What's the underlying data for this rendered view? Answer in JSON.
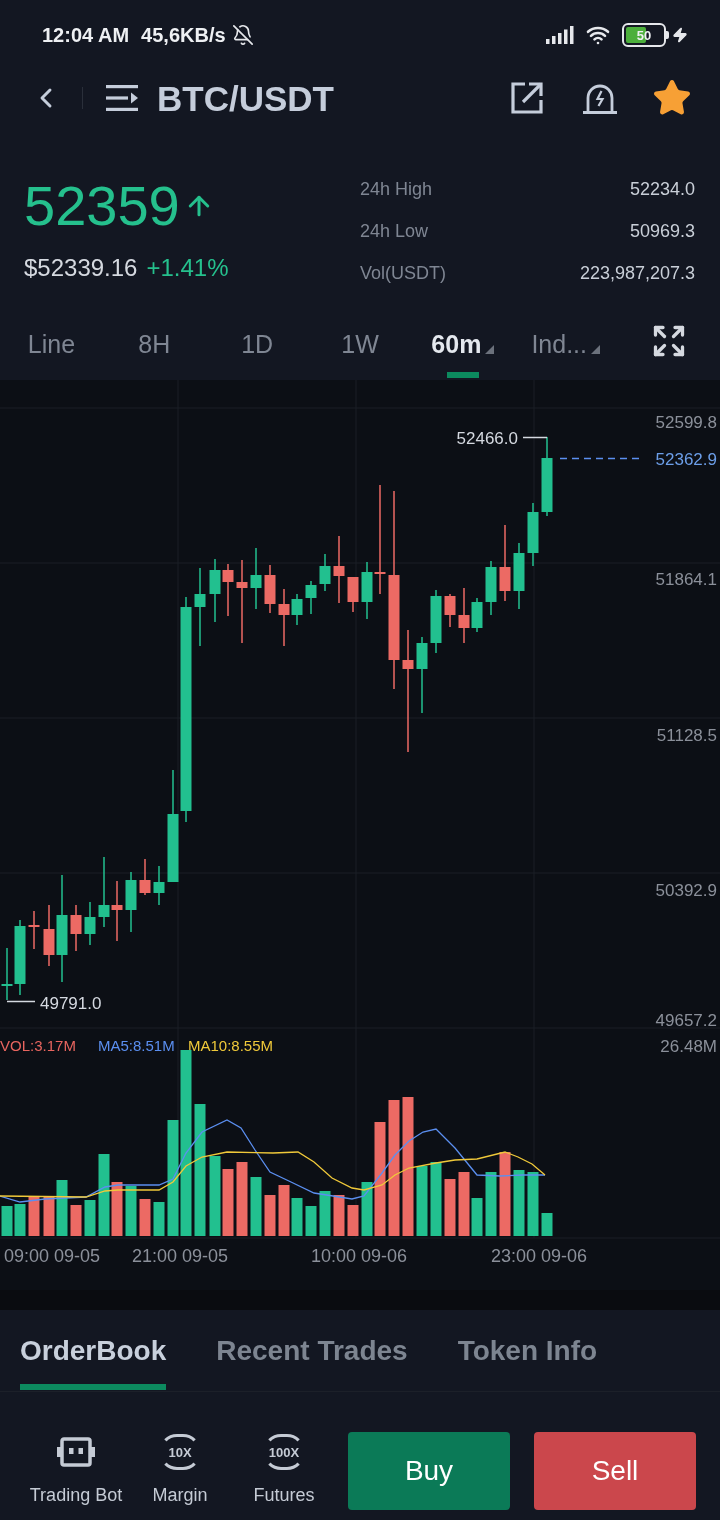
{
  "status_bar": {
    "time": "12:04 AM",
    "speed": "45,6KB/s",
    "battery": "50"
  },
  "header": {
    "title": "BTC/USDT",
    "favorite": true
  },
  "ticker": {
    "price": "52359",
    "fiat_price": "$52339.16",
    "change": "+1.41%",
    "stats": [
      {
        "label": "24h High",
        "value": "52234.0"
      },
      {
        "label": "24h Low",
        "value": "50969.3"
      },
      {
        "label": "Vol(USDT)",
        "value": "223,987,207.3"
      }
    ]
  },
  "intervals": [
    {
      "label": "Line",
      "selected": false,
      "kind": "plain"
    },
    {
      "label": "8H",
      "selected": false,
      "kind": "plain"
    },
    {
      "label": "1D",
      "selected": false,
      "kind": "plain"
    },
    {
      "label": "1W",
      "selected": false,
      "kind": "plain"
    },
    {
      "label": "60m",
      "selected": true,
      "kind": "dropdown"
    },
    {
      "label": "Ind...",
      "selected": false,
      "kind": "dropdown"
    }
  ],
  "chart": {
    "price_axis": [
      "52599.8",
      "51864.1",
      "51128.5",
      "50392.9",
      "49657.2"
    ],
    "high_marker": "52466.0",
    "last_price": "52362.9",
    "low_marker": "49791.0",
    "volume_legend": [
      {
        "label": "VOL:3.17M",
        "color": "#e8655f"
      },
      {
        "label": "MA5:8.51M",
        "color": "#5b8ff0"
      },
      {
        "label": "MA10:8.55M",
        "color": "#f0c93a"
      }
    ],
    "volume_axis": "26.48M",
    "time_axis": [
      "09:00 09-05",
      "21:00 09-05",
      "10:00 09-06",
      "23:00 09-06"
    ]
  },
  "info_tabs": [
    {
      "label": "OrderBook",
      "selected": true
    },
    {
      "label": "Recent Trades",
      "selected": false
    },
    {
      "label": "Token Info",
      "selected": false
    }
  ],
  "actions": [
    {
      "label": "Trading Bot",
      "kind": "bot"
    },
    {
      "label": "Margin",
      "kind": "leverage",
      "badge": "10X"
    },
    {
      "label": "Futures",
      "kind": "leverage",
      "badge": "100X"
    }
  ],
  "trade_buttons": [
    {
      "label": "Buy",
      "kind": "buy"
    },
    {
      "label": "Sell",
      "kind": "sell"
    }
  ]
}
